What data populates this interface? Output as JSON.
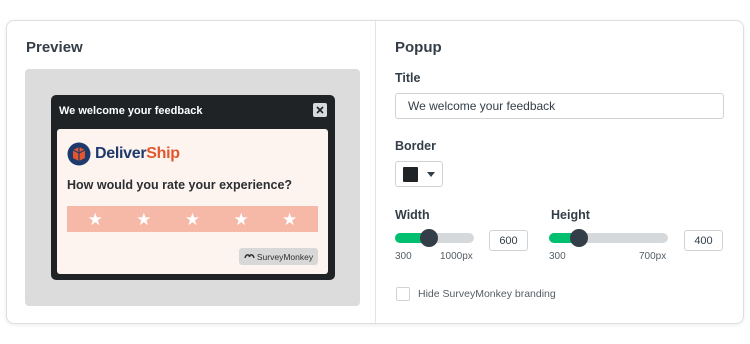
{
  "preview": {
    "title": "Preview",
    "popup": {
      "header": "We welcome your feedback",
      "brand_part1": "Deliver",
      "brand_part2": "Ship",
      "question": "How would you rate your experience?",
      "stars": 5,
      "badge": "SurveyMonkey"
    }
  },
  "popup_settings": {
    "title": "Popup",
    "title_label": "Title",
    "title_value": "We welcome your feedback",
    "border_label": "Border",
    "border_color": "#1f2326",
    "width": {
      "label": "Width",
      "value": "600",
      "min_label": "300",
      "max_label": "1000px",
      "min": 300,
      "max": 1000,
      "current": 600
    },
    "height": {
      "label": "Height",
      "value": "400",
      "min_label": "300",
      "max_label": "700px",
      "min": 300,
      "max": 700,
      "current": 400
    },
    "branding_label": "Hide SurveyMonkey branding",
    "branding_checked": false
  },
  "colors": {
    "accent": "#00bf6f",
    "brand_navy": "#1e3a6d",
    "brand_orange": "#e4572e",
    "star_bar": "#f6b9a8"
  }
}
